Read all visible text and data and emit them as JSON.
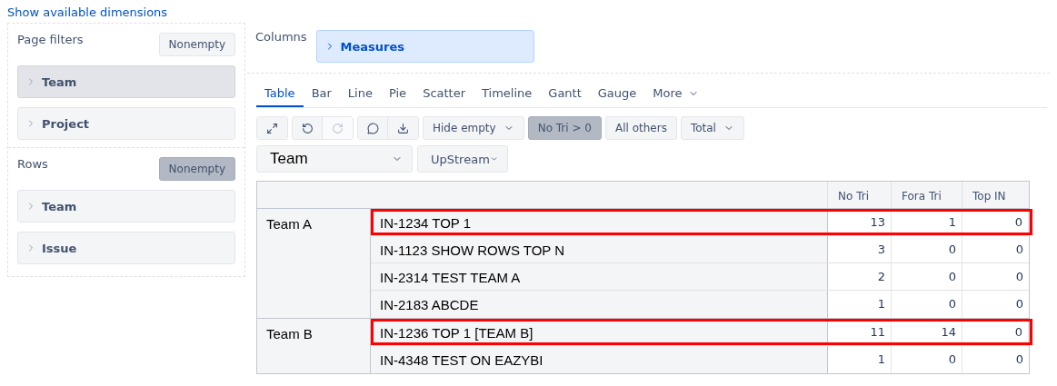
{
  "link": "Show available dimensions",
  "page_filters": {
    "title": "Page filters",
    "nonempty": {
      "label": "Nonempty",
      "selected": false
    },
    "items": [
      {
        "label": "Team",
        "selected": true
      },
      {
        "label": "Project",
        "selected": false
      }
    ]
  },
  "rows_panel": {
    "title": "Rows",
    "nonempty": {
      "label": "Nonempty",
      "selected": true
    },
    "items": [
      {
        "label": "Team",
        "selected": false
      },
      {
        "label": "Issue",
        "selected": false
      }
    ]
  },
  "columns": {
    "title": "Columns",
    "items": [
      {
        "label": "Measures"
      }
    ]
  },
  "tabs": [
    {
      "label": "Table",
      "selected": true
    },
    {
      "label": "Bar",
      "selected": false
    },
    {
      "label": "Line",
      "selected": false
    },
    {
      "label": "Pie",
      "selected": false
    },
    {
      "label": "Scatter",
      "selected": false
    },
    {
      "label": "Timeline",
      "selected": false
    },
    {
      "label": "Gantt",
      "selected": false
    },
    {
      "label": "Gauge",
      "selected": false
    },
    {
      "label": "More",
      "selected": false
    }
  ],
  "toolbar": [
    {
      "kind": "icons",
      "icons": [
        {
          "kind": "expand",
          "disabled": false
        }
      ]
    },
    {
      "kind": "icons",
      "icons": [
        {
          "kind": "undo",
          "disabled": false
        },
        {
          "kind": "redo",
          "disabled": true
        }
      ]
    },
    {
      "kind": "icons",
      "icons": [
        {
          "kind": "comment",
          "disabled": false
        },
        {
          "kind": "download",
          "disabled": false
        }
      ]
    },
    {
      "kind": "dropdown",
      "label": "Hide empty",
      "selected": false
    },
    {
      "kind": "toggle",
      "label": "No Tri > 0",
      "selected": true
    },
    {
      "kind": "toggle",
      "label": "All others",
      "selected": false
    },
    {
      "kind": "dropdown",
      "label": "Total",
      "selected": false
    }
  ],
  "selectors": [
    {
      "kind": "wide",
      "value": "Team"
    },
    {
      "kind": "narrow",
      "value": "UpStream"
    }
  ],
  "table": {
    "columns": [
      "No Tri",
      "Fora Tri",
      "Top IN"
    ],
    "groups": [
      {
        "team": "Team A",
        "rows": [
          {
            "label": "IN-1234 TOP 1",
            "values": [
              "13",
              "1",
              "0"
            ],
            "highlighted": true
          },
          {
            "label": "IN-1123 SHOW ROWS TOP N",
            "values": [
              "3",
              "0",
              "0"
            ],
            "highlighted": false
          },
          {
            "label": "IN-2314 TEST TEAM A",
            "values": [
              "2",
              "0",
              "0"
            ],
            "highlighted": false
          },
          {
            "label": "IN-2183 ABCDE",
            "values": [
              "1",
              "0",
              "0"
            ],
            "highlighted": false
          }
        ]
      },
      {
        "team": "Team B",
        "rows": [
          {
            "label": "IN-1236 TOP 1 [TEAM B]",
            "values": [
              "11",
              "14",
              "0"
            ],
            "highlighted": true
          },
          {
            "label": "IN-4348 TEST ON EAZYBI",
            "values": [
              "1",
              "0",
              "0"
            ],
            "highlighted": false
          }
        ]
      }
    ]
  }
}
